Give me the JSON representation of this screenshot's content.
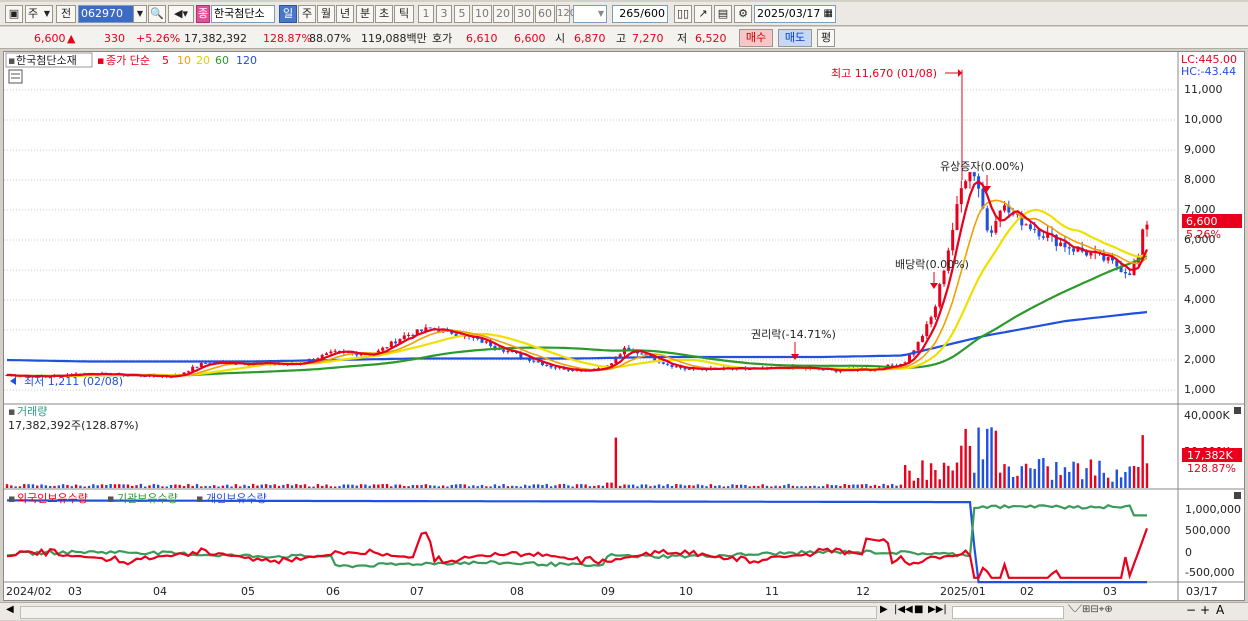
{
  "toolbar": {
    "market": "주",
    "prev_label": "전",
    "code": "062970",
    "stock_name": "한국첨단소",
    "period_tabs": [
      "일",
      "주",
      "월",
      "년",
      "분",
      "초",
      "틱"
    ],
    "active_tab": "일",
    "intervals": [
      "1",
      "3",
      "5",
      "10",
      "20",
      "30",
      "60",
      "120"
    ],
    "count": "265",
    "count_max": "/600",
    "date": "2025/03/17",
    "indicator_badge": "종"
  },
  "quote": {
    "price": "6,600",
    "arrow": "▲",
    "change": "330",
    "change_pct": "+5.26%",
    "volume": "17,382,392",
    "vol_ratio": "128.87%",
    "turnover": "88.07%",
    "amount": "119,088백만",
    "ask_label": "호가",
    "ask": "6,610",
    "bid": "6,600",
    "open_label": "시",
    "open": "6,870",
    "high_label": "고",
    "high": "7,270",
    "low_label": "저",
    "low": "6,520",
    "buy_button": "매수",
    "sell_button": "매도",
    "eval_button": "평"
  },
  "price_panel": {
    "stock_name": "한국첨단소재",
    "ma_label": "종가 단순",
    "ma_periods": [
      "5",
      "10",
      "20",
      "60",
      "120"
    ],
    "ma_colors": [
      "#e8001c",
      "#f0a000",
      "#f0e000",
      "#2a9a2a",
      "#2050e0"
    ],
    "lc_label": "LC:445.00",
    "hc_label": "HC:-43.44",
    "y_ticks": [
      "11,000",
      "10,000",
      "9,000",
      "8,000",
      "7,000",
      "6,000",
      "5,000",
      "4,000",
      "3,000",
      "2,000",
      "1,000"
    ],
    "current_price": "6,600",
    "current_pct": "5.26%",
    "annotations": {
      "high": "최고 11,670 (01/08)",
      "low": "최저 1,211 (02/08)",
      "rights_issue": "권리락(-14.71%)",
      "dividend": "배당락(0.00%)",
      "bonus_issue": "유상증자(0.00%)"
    }
  },
  "volume_panel": {
    "title": "거래량",
    "value": "17,382,392주(128.87%)",
    "y_ticks": [
      "40,000K",
      "20,000K"
    ],
    "current": "17,382K",
    "current_pct": "128.87%"
  },
  "holdings_panel": {
    "legend": [
      "외국인보유수량",
      "기관보유수량",
      "개인보유수량"
    ],
    "legend_colors": [
      "#e8001c",
      "#2a9a2a",
      "#2050e0"
    ],
    "y_ticks": [
      "1,000,000",
      "500,000",
      "0",
      "-500,000"
    ]
  },
  "x_axis": {
    "labels": [
      "2024/02",
      "03",
      "04",
      "05",
      "06",
      "07",
      "08",
      "09",
      "10",
      "11",
      "12",
      "2025/01",
      "02",
      "03"
    ],
    "last_date": "03/17"
  },
  "chart_data": {
    "type": "line",
    "x": [
      "2024/02",
      "2024/03",
      "2024/04",
      "2024/05",
      "2024/06",
      "2024/07",
      "2024/08",
      "2024/09",
      "2024/10",
      "2024/11",
      "2024/12",
      "2025/01",
      "2025/02",
      "2025/03",
      "2025/03/17"
    ],
    "series": [
      {
        "name": "5",
        "values": [
          1500,
          1700,
          1950,
          1900,
          2250,
          3000,
          2000,
          2300,
          1700,
          1750,
          1700,
          8500,
          6500,
          5500,
          6600
        ]
      },
      {
        "name": "120",
        "values": [
          2000,
          1950,
          1950,
          1950,
          2000,
          2050,
          2050,
          2050,
          2100,
          2100,
          2100,
          2150,
          2800,
          3300,
          3600
        ]
      }
    ],
    "volume_values": [
      1500,
      1800,
      3000,
      1500,
      2500,
      3500,
      1200,
      28000,
      2500,
      2000,
      3000,
      40000,
      20000,
      10000,
      17382
    ],
    "ylim": [
      1000,
      11670
    ]
  }
}
